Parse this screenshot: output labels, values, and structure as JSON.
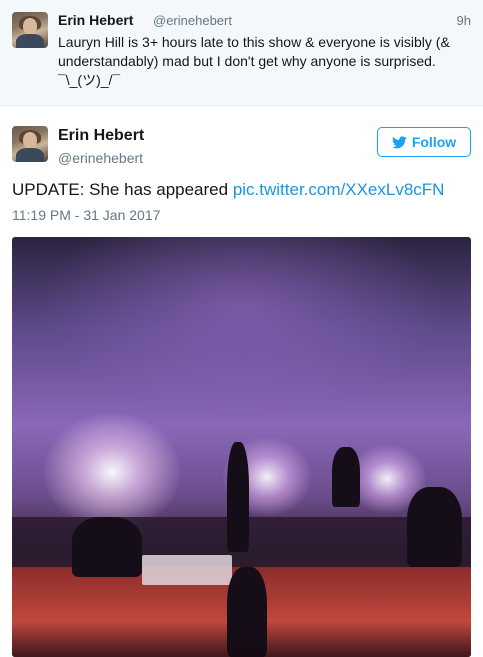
{
  "parent_tweet": {
    "name": "Erin Hebert",
    "handle": "@erinehebert",
    "time": "9h",
    "text": "Lauryn Hill is 3+ hours late to this show & everyone is visibly (& understandably) mad but I don't get why anyone is surprised. ¯\\_(ツ)_/¯"
  },
  "main_tweet": {
    "name": "Erin Hebert",
    "handle": "@erinehebert",
    "follow_label": "Follow",
    "text": "UPDATE: She has appeared ",
    "link": "pic.twitter.com/XXexLv8cFN",
    "timestamp": "11:19 PM - 31 Jan 2017"
  },
  "colors": {
    "accent": "#1da1f2",
    "link": "#1b95e0",
    "muted": "#657786",
    "parent_bg": "#f5f8fa"
  },
  "icons": {
    "follow": "twitter-bird-icon"
  }
}
